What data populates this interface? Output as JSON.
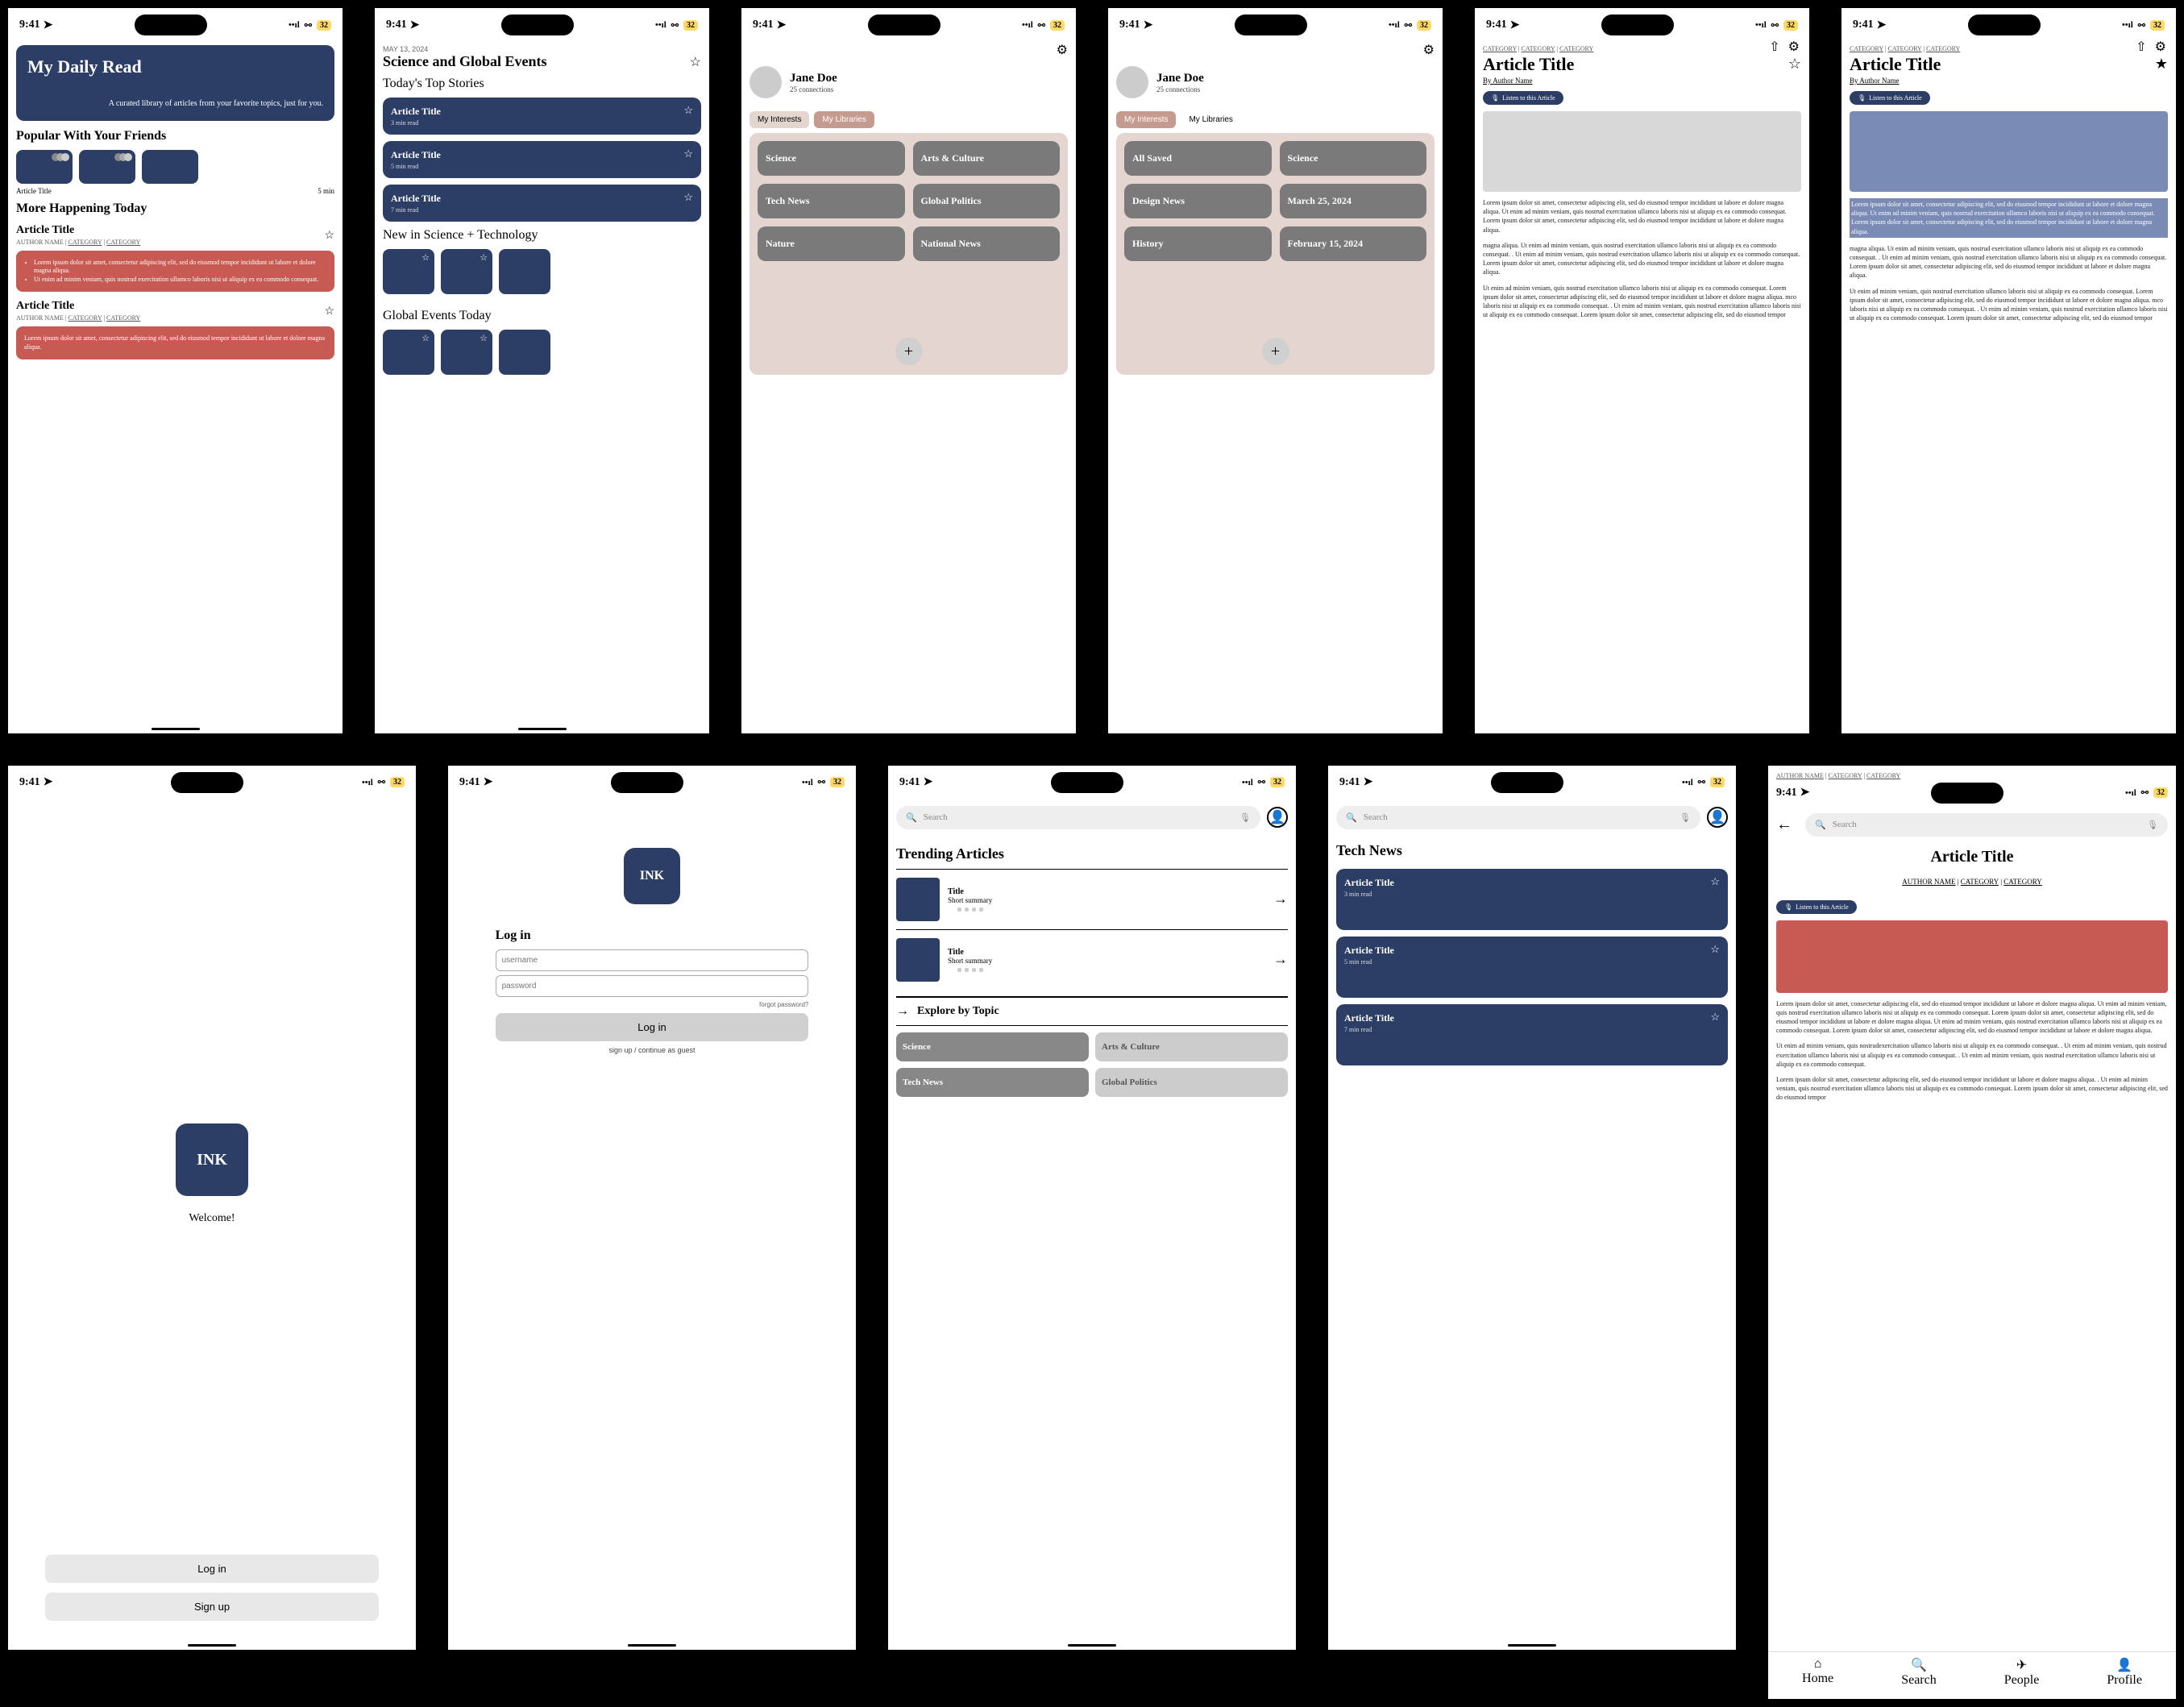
{
  "status": {
    "time": "9:41",
    "badge": "32"
  },
  "s1": {
    "hero_title": "My Daily Read",
    "hero_sub": "A curated library of articles from your favorite topics, just for you.",
    "sec1": "Popular With Your Friends",
    "card_title": "Article Title",
    "card_min": "5 min",
    "sec2": "More Happening Today",
    "a_title": "Article Title",
    "a_by": "AUTHOR NAME | ",
    "cat": "CATEGORY",
    "ex1": "Lorem ipsum dolor sit amet, consectetur adipiscing elit, sed do eiusmod tempor incididunt ut labore et dolore magna aliqua.",
    "ex2": "Ut enim ad minim veniam, quis nostrud exercitation ullamco laboris nisi ut aliquip ex ea commodo consequat.",
    "ex3": "Lorem ipsum dolor sit amet, consectetur adipiscing elit, sed do eiusmod tempor incididunt ut labore et dolore magna aliqua."
  },
  "s2": {
    "date": "MAY 13, 2024",
    "title": "Science and Global Events",
    "sec1": "Today's Top Stories",
    "stories": [
      {
        "t": "Article Title",
        "m": "3 min read"
      },
      {
        "t": "Article Title",
        "m": "5 min read"
      },
      {
        "t": "Article Title",
        "m": "7 min read"
      }
    ],
    "sec2": "New in Science + Technology",
    "sec3": "Global Events Today"
  },
  "s3": {
    "name": "Jane Doe",
    "conn": "25 connections",
    "tab1": "My Interests",
    "tab2": "My Libraries",
    "chips": [
      "Science",
      "Arts & Culture",
      "Tech News",
      "Global Politics",
      "Nature",
      "National News"
    ]
  },
  "s4": {
    "name": "Jane Doe",
    "conn": "25 connections",
    "tab1": "My Interests",
    "tab2": "My Libraries",
    "chips": [
      "All Saved",
      "Science",
      "Design News",
      "March 25, 2024",
      "History",
      "February 15, 2024"
    ]
  },
  "s5": {
    "crumb": "CATEGORY",
    "title": "Article Title",
    "by_pre": "By ",
    "by": "Author Name",
    "listen": "Listen to this Article",
    "p1": "Lorem ipsum dolor sit amet, consectetur adipiscing elit, sed do eiusmod tempor incididunt ut labore et dolore magna aliqua. Ut enim ad minim veniam, quis nostrud exercitation ullamco laboris nisi ut aliquip ex ea commodo consequat. Lorem ipsum dolor sit amet, consectetur adipiscing elit, sed do eiusmod tempor incididunt ut labore et dolore magna aliqua.",
    "p2": "magna aliqua. Ut enim ad minim veniam, quis nostrud exercitation ullamco laboris nisi ut aliquip ex ea commodo consequat. . Ut enim ad minim veniam, quis nostrud exercitation ullamco laboris nisi ut aliquip ex ea commodo consequat. Lorem ipsum dolor sit amet, consectetur adipiscing elit, sed do eiusmod tempor incididunt ut labore et dolore magna aliqua.",
    "p3": "Ut enim ad minim veniam, quis nostrud exercitation ullamco laboris nisi ut aliquip ex ea commodo consequat. Lorem ipsum dolor sit amet, consectetur adipiscing elit, sed do eiusmod tempor incididunt ut labore et dolore magna aliqua. mco laboris nisi ut aliquip ex ea commodo consequat. . Ut enim ad minim veniam, quis nostrud exercitation ullamco laboris nisi ut aliquip ex ea commodo consequat. Lorem ipsum dolor sit amet, consectetur adipiscing elit, sed do eiusmod tempor"
  },
  "s7": {
    "logo": "INK",
    "welcome": "Welcome!",
    "login": "Log in",
    "signup": "Sign up"
  },
  "s8": {
    "logo": "INK",
    "h": "Log in",
    "user_ph": "username",
    "pass_ph": "password",
    "forgot": "forgot password?",
    "btn": "Log in",
    "guest": "sign up / continue as guest"
  },
  "s9": {
    "search": "Search",
    "h": "Trending Articles",
    "item_t": "Title",
    "item_s": "Short summary",
    "explore": "Explore by Topic",
    "topics": [
      "Science",
      "Arts & Culture",
      "Tech News",
      "Global Politics"
    ]
  },
  "s10": {
    "search": "Search",
    "h": "Tech News",
    "stories": [
      {
        "t": "Article Title",
        "m": "3 min read"
      },
      {
        "t": "Article Title",
        "m": "5 min read"
      },
      {
        "t": "Article Title",
        "m": "7 min read"
      }
    ]
  },
  "s11": {
    "crumb_by": "AUTHOR NAME",
    "crumb_cat": "CATEGORY",
    "search": "Search",
    "title": "Article Title",
    "by": "AUTHOR NAME",
    "cat": "CATEGORY",
    "listen": "Listen to this Article",
    "p1": "Lorem ipsum dolor sit amet, consectetur adipiscing elit, sed do eiusmod tempor incididunt ut labore et dolore magna aliqua. Ut enim ad minim veniam, quis nostrud exercitation ullamco laboris nisi ut aliquip ex ea commodo consequat. Lorem ipsum dolor sit amet, consectetur adipiscing elit, sed do eiusmod tempor incididunt ut labore et dolore magna aliqua. Ut enim ad minim veniam, quis nostrud exercitation ullamco laboris nisi ut aliquip ex ea commodo consequat. Lorem ipsum dolor sit amet, consectetur adipiscing elit, sed do eiusmod tempor incididunt ut labore et dolore magna aliqua.",
    "p2": "Ut enim ad minim veniam, quis nostrudexercitation ullamco laboris nisi ut aliquip ex ea commodo consequat. . Ut enim ad minim veniam, quis nostrud exercitation ullamco laboris nisi ut aliquip ex ea commodo consequat. . Ut enim ad minim veniam, quis nostrud exercitation ullamco laboris nisi ut aliquip ex ea commodo consequat.",
    "p3": "Lorem ipsum dolor sit amet, consectetur adipiscing elit, sed do eiusmod tempor incididunt ut labore et dolore magna aliqua. . Ut enim ad minim veniam, quis nostrud exercitation ullamco laboris nisi ut aliquip ex ea commodo consequat. Lorem ipsum dolor sit amet, consectetur adipiscing elit, sed do eiusmod tempor",
    "nav": [
      "Home",
      "Search",
      "People",
      "Profile"
    ]
  }
}
